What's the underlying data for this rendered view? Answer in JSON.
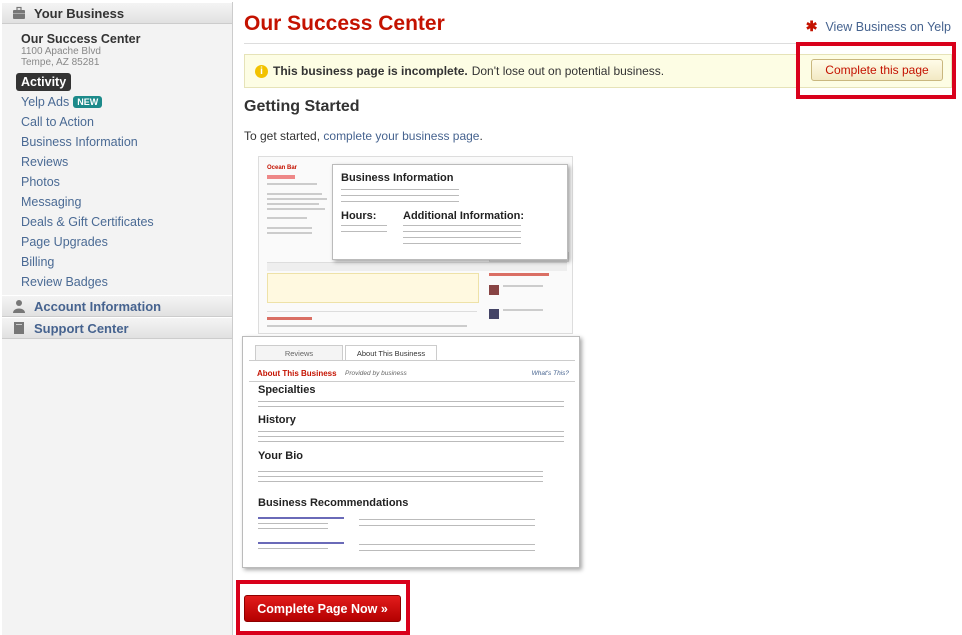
{
  "sidebar": {
    "section_title": "Your Business",
    "business": {
      "name": "Our Success Center",
      "address1": "1100 Apache Blvd",
      "address2": "Tempe, AZ 85281"
    },
    "items": [
      {
        "label": "Activity"
      },
      {
        "label": "Yelp Ads",
        "badge": "NEW"
      },
      {
        "label": "Call to Action"
      },
      {
        "label": "Business Information"
      },
      {
        "label": "Reviews"
      },
      {
        "label": "Photos"
      },
      {
        "label": "Messaging"
      },
      {
        "label": "Deals & Gift Certificates"
      },
      {
        "label": "Page Upgrades"
      },
      {
        "label": "Billing"
      },
      {
        "label": "Review Badges"
      }
    ],
    "account": "Account Information",
    "support": "Support Center"
  },
  "main": {
    "title": "Our Success Center",
    "view_link": "View Business on Yelp",
    "alert_bold": "This business page is incomplete.",
    "alert_text": "Don't lose out on potential business.",
    "complete_button": "Complete this page",
    "heading": "Getting Started",
    "intro_prefix": "To get started, ",
    "intro_link": "complete your business page",
    "intro_suffix": ".",
    "cta": "Complete Page Now »"
  },
  "illustration": {
    "listing_name": "Ocean Bar",
    "popup1": {
      "title": "Business Information",
      "hours": "Hours:",
      "additional": "Additional Information:"
    },
    "popup2": {
      "tab1": "Reviews",
      "tab2": "About This Business",
      "section": "About This Business",
      "provided": "Provided by business",
      "whats_this": "What's This?",
      "specialties": "Specialties",
      "history": "History",
      "bio": "Your Bio",
      "recs": "Business Recommendations"
    }
  },
  "colors": {
    "brand_red": "#c41200",
    "link_blue": "#46638f",
    "highlight_box": "#d9001b",
    "new_badge": "#1c8a8a"
  }
}
